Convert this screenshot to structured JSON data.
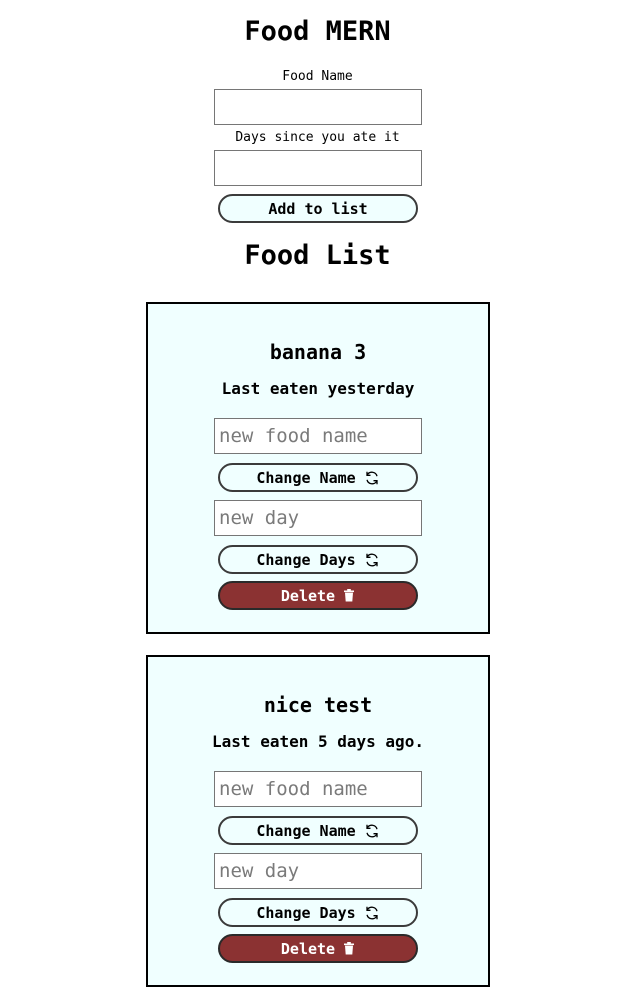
{
  "header": {
    "title": "Food MERN"
  },
  "form": {
    "food_name_label": "Food Name",
    "food_name_value": "",
    "days_label": "Days since you ate it",
    "days_value": "",
    "add_button_label": "Add to list"
  },
  "list": {
    "title": "Food List",
    "items": [
      {
        "title": "banana 3",
        "last_eaten": "Last eaten yesterday",
        "name_placeholder": "new food name",
        "change_name_label": "Change Name",
        "day_placeholder": "new day",
        "change_days_label": "Change Days",
        "delete_label": "Delete"
      },
      {
        "title": "nice test",
        "last_eaten": "Last eaten 5 days ago.",
        "name_placeholder": "new food name",
        "change_name_label": "Change Name",
        "day_placeholder": "new day",
        "change_days_label": "Change Days",
        "delete_label": "Delete"
      }
    ]
  },
  "icons": {
    "change_name": "refresh-icon",
    "change_days": "refresh-icon",
    "delete": "trash-icon"
  },
  "colors": {
    "card_background": "#f0ffff",
    "button_background": "#f0ffff",
    "delete_background": "#8b3232",
    "delete_text": "#ffffff"
  }
}
